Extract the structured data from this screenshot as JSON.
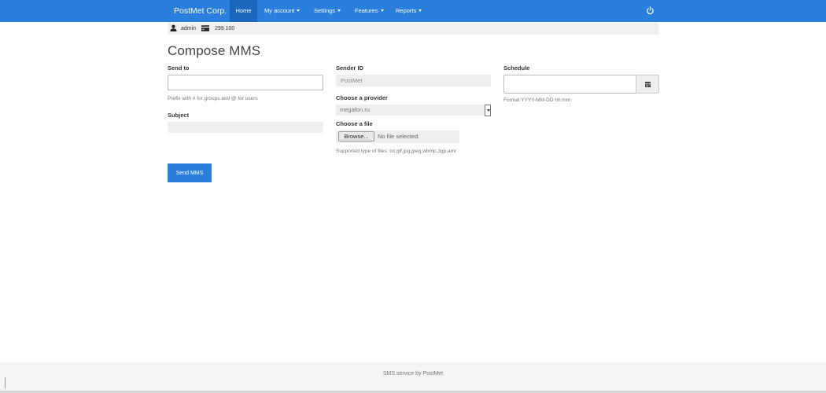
{
  "navbar": {
    "brand": "PostMet Corp.",
    "items": [
      {
        "label": "Home",
        "active": true,
        "dropdown": false
      },
      {
        "label": "My account",
        "active": false,
        "dropdown": true
      },
      {
        "label": "Settings",
        "active": false,
        "dropdown": true
      },
      {
        "label": "Features",
        "active": false,
        "dropdown": true
      },
      {
        "label": "Reports",
        "active": false,
        "dropdown": true
      }
    ],
    "power_icon": "power-icon",
    "color": "#2a7fdc"
  },
  "userbar": {
    "user_icon": "user-icon",
    "username": "admin",
    "credit_icon": "credit-card-icon",
    "balance": "299.100"
  },
  "page": {
    "title": "Compose MMS"
  },
  "form": {
    "send_to": {
      "label": "Send to",
      "value": "",
      "help": "Prefix with # for groups and @ for users"
    },
    "subject": {
      "label": "Subject",
      "value": ""
    },
    "sender_id": {
      "label": "Sender ID",
      "value": "PostMet"
    },
    "provider": {
      "label": "Choose a provider",
      "selected": "megafon.ru"
    },
    "file": {
      "label": "Choose a file",
      "browse_label": "Browse...",
      "status": "No file selected.",
      "help": "Supported type of files: txt,gif,jpg,jpeg,wbmp,3gp,amr"
    },
    "schedule": {
      "label": "Schedule",
      "value": "",
      "help": "Format YYYY-MM-DD hh:mm",
      "calendar_icon": "calendar-icon"
    },
    "submit_label": "Send MMS"
  },
  "footer": {
    "text": "SMS service by PostMet"
  }
}
